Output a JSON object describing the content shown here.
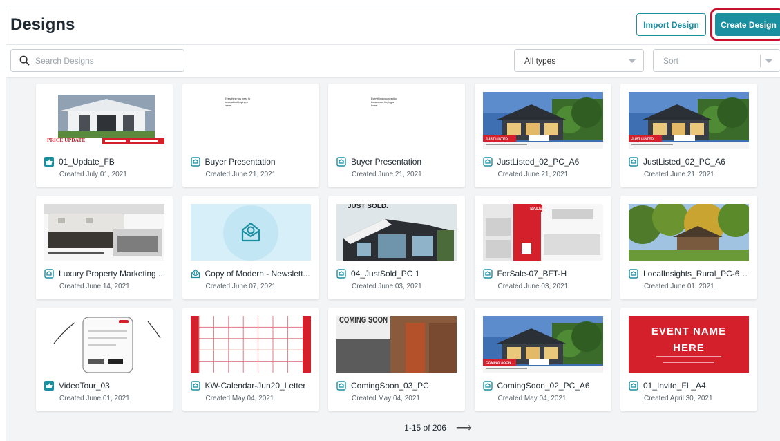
{
  "header": {
    "title": "Designs",
    "import_label": "Import Design",
    "create_label": "Create Design"
  },
  "toolbar": {
    "search_placeholder": "Search Designs",
    "type_filter": "All types",
    "sort_label": "Sort"
  },
  "colors": {
    "accent": "#1a8fa0",
    "highlight": "#c8102e",
    "brand_red": "#d3202b"
  },
  "designs": [
    {
      "name": "01_Update_FB",
      "created": "Created July 01, 2021",
      "icon": "facebook-icon",
      "thumb": "price-update"
    },
    {
      "name": "Buyer Presentation",
      "created": "Created June 21, 2021",
      "icon": "document-icon",
      "thumb": "buyer-text"
    },
    {
      "name": "Buyer Presentation",
      "created": "Created June 21, 2021",
      "icon": "document-icon",
      "thumb": "buyer-text"
    },
    {
      "name": "JustListed_02_PC_A6",
      "created": "Created June 21, 2021",
      "icon": "document-icon",
      "thumb": "house-listed"
    },
    {
      "name": "JustListed_02_PC_A6",
      "created": "Created June 21, 2021",
      "icon": "document-icon",
      "thumb": "house-listed"
    },
    {
      "name": "Luxury Property Marketing ...",
      "created": "Created June 14, 2021",
      "icon": "document-icon",
      "thumb": "kitchen"
    },
    {
      "name": "Copy of Modern - Newslett...",
      "created": "Created June 07, 2021",
      "icon": "newsletter-icon",
      "thumb": "newsletter"
    },
    {
      "name": "04_JustSold_PC 1",
      "created": "Created June 03, 2021",
      "icon": "document-icon",
      "thumb": "just-sold"
    },
    {
      "name": "ForSale-07_BFT-H",
      "created": "Created June 03, 2021",
      "icon": "document-icon",
      "thumb": "for-sale"
    },
    {
      "name": "LocalInsights_Rural_PC-6x...",
      "created": "Created June 01, 2021",
      "icon": "document-icon",
      "thumb": "rural"
    },
    {
      "name": "VideoTour_03",
      "created": "Created June 01, 2021",
      "icon": "facebook-icon",
      "thumb": "video-tour"
    },
    {
      "name": "KW-Calendar-Jun20_Letter",
      "created": "Created May 04, 2021",
      "icon": "document-icon",
      "thumb": "calendar"
    },
    {
      "name": "ComingSoon_03_PC",
      "created": "Created May 04, 2021",
      "icon": "document-icon",
      "thumb": "coming-soon-door"
    },
    {
      "name": "ComingSoon_02_PC_A6",
      "created": "Created May 04, 2021",
      "icon": "document-icon",
      "thumb": "house-coming"
    },
    {
      "name": "01_Invite_FL_A4",
      "created": "Created April 30, 2021",
      "icon": "document-icon",
      "thumb": "event"
    }
  ],
  "thumb_text": {
    "price_update": "PRICE UPDATE",
    "buyer_text": "Everything you need to know about buying a home.",
    "just_listed": "JUST LISTED",
    "just_sold": "JUST SOLD.",
    "sale": "SALE",
    "coming_soon_badge": "COMING SOON",
    "coming_soon_big": "COMING SOON",
    "event_line1": "EVENT NAME",
    "event_line2": "HERE"
  },
  "pagination": {
    "range": "1-15 of 206",
    "next_symbol": "⟶"
  }
}
